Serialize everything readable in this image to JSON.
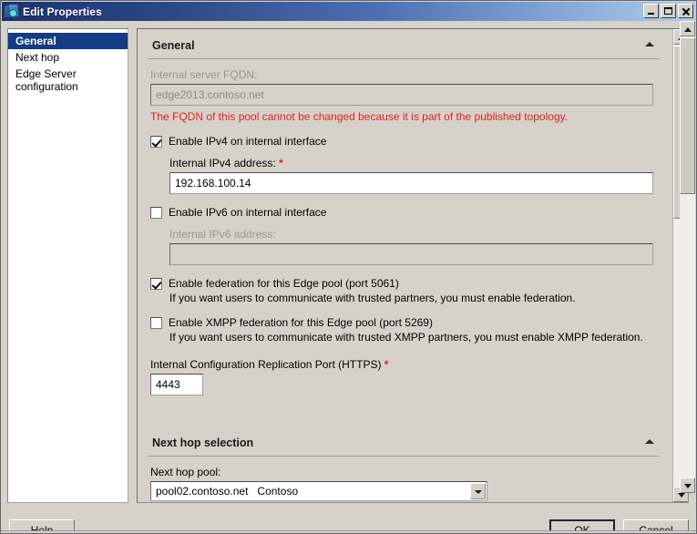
{
  "window": {
    "title": "Edit Properties",
    "icon": "topology-builder-icon",
    "controls": {
      "minimize": "Minimize",
      "maximize": "Maximize",
      "close": "Close"
    }
  },
  "sidebar": {
    "items": [
      {
        "label": "General",
        "selected": true
      },
      {
        "label": "Next hop",
        "selected": false
      },
      {
        "label": "Edge Server configuration",
        "selected": false
      }
    ]
  },
  "main": {
    "sections": [
      {
        "title": "General",
        "collapse_icon": "chevron-up-icon",
        "fqdn_label": "Internal server FQDN:",
        "fqdn_value": "edge2013.contoso.net",
        "fqdn_warning": "The FQDN of this pool cannot be changed because it is part of the published topology.",
        "ipv4_checkbox_label": "Enable IPv4 on internal interface",
        "ipv4_checked": true,
        "ipv4_address_label": "Internal IPv4 address:",
        "ipv4_address_required": "*",
        "ipv4_address_value": "192.168.100.14",
        "ipv6_checkbox_label": "Enable IPv6 on internal interface",
        "ipv6_checked": false,
        "ipv6_address_label": "Internal IPv6 address:",
        "ipv6_address_value": "",
        "federation_checkbox_label": "Enable federation for this Edge pool (port 5061)",
        "federation_checked": true,
        "federation_note": "If you want users to communicate with trusted partners, you must enable federation.",
        "xmpp_checkbox_label": "Enable XMPP federation for this Edge pool (port 5269)",
        "xmpp_checked": false,
        "xmpp_note": "If you want users to communicate with trusted XMPP partners, you must enable XMPP federation.",
        "replication_port_label": "Internal Configuration Replication Port (HTTPS)",
        "replication_port_required": "*",
        "replication_port_value": "4443"
      },
      {
        "title": "Next hop selection",
        "collapse_icon": "chevron-up-icon",
        "next_hop_label": "Next hop pool:",
        "next_hop_value": "pool02.contoso.net   Contoso"
      }
    ]
  },
  "footer": {
    "help_label": "Help",
    "ok_label": "OK",
    "cancel_label": "Cancel"
  },
  "colors": {
    "title_bar_start": "#1b3270",
    "title_bar_end": "#b3cbe8",
    "selection": "#133b86",
    "warning_red": "#e02020",
    "dialog_face": "#d6d2ca"
  }
}
